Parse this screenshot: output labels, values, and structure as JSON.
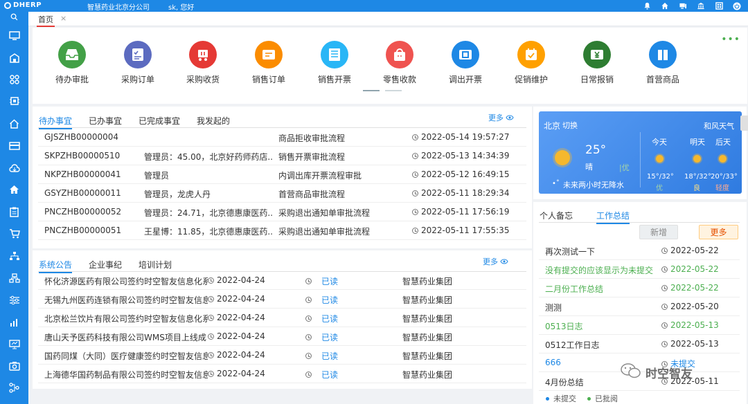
{
  "app": {
    "logo": "DHERP",
    "company": "智慧药业北京分公司",
    "greeting": "sk, 您好"
  },
  "tabs": {
    "home": "首页",
    "close": "×"
  },
  "modules": [
    {
      "label": "待办审批",
      "color": "#43a047",
      "icon": "inbox-tray-icon"
    },
    {
      "label": "采购订单",
      "color": "#5c6bc0",
      "icon": "checklist-icon"
    },
    {
      "label": "采购收货",
      "color": "#e53935",
      "icon": "cart-icon"
    },
    {
      "label": "销售订单",
      "color": "#fb8c00",
      "icon": "receipt-icon"
    },
    {
      "label": "销售开票",
      "color": "#29b6f6",
      "icon": "invoice-icon"
    },
    {
      "label": "零售收款",
      "color": "#ef5350",
      "icon": "shop-bag-icon"
    },
    {
      "label": "调出开票",
      "color": "#1e88e5",
      "icon": "transfer-invoice-icon"
    },
    {
      "label": "促销维护",
      "color": "#ffa000",
      "icon": "calendar-check-icon"
    },
    {
      "label": "日常报销",
      "color": "#2e7d32",
      "icon": "yen-ticket-icon"
    },
    {
      "label": "首营商品",
      "color": "#1e88e5",
      "icon": "product-box-icon"
    }
  ],
  "tasks": {
    "tabs": [
      "待办事宜",
      "已办事宜",
      "已完成事宜",
      "我发起的"
    ],
    "more": "更多",
    "rows": [
      {
        "id": "GJSZHB00000004",
        "desc": "",
        "flow": "商品拒收审批流程",
        "time": "2022-05-14 19:57:27"
      },
      {
        "id": "SKPZHB00000510",
        "desc": "管理员：45.00，北京好药师药店...",
        "flow": "销售开票审批流程",
        "time": "2022-05-13 14:34:39"
      },
      {
        "id": "NKPZHB00000041",
        "desc": "管理员",
        "flow": "内调出库开票流程审批",
        "time": "2022-05-12 16:49:15"
      },
      {
        "id": "GSYZHB00000011",
        "desc": "管理员，龙虎人丹",
        "flow": "首营商品审批流程",
        "time": "2022-05-11 18:29:34"
      },
      {
        "id": "PNCZHB00000052",
        "desc": "管理员：24.71，北京德惠康医药...",
        "flow": "采购退出通知单审批流程",
        "time": "2022-05-11 17:56:19"
      },
      {
        "id": "PNCZHB00000051",
        "desc": "王星博：11.85，北京德惠康医药...",
        "flow": "采购退出通知单审批流程",
        "time": "2022-05-11 17:55:35"
      }
    ]
  },
  "notices": {
    "tabs": [
      "系统公告",
      "企业事纪",
      "培训计划"
    ],
    "more": "更多",
    "rows": [
      {
        "title": "怀化济源医药有限公司签约时空智友信息化系",
        "date": "2022-04-24",
        "status": "已读",
        "org": "智慧药业集团"
      },
      {
        "title": "无锡九州医药连锁有限公司签约时空智友信息",
        "date": "2022-04-24",
        "status": "已读",
        "org": "智慧药业集团"
      },
      {
        "title": "北京松兰饮片有限公司签约时空智友信息化系",
        "date": "2022-04-24",
        "status": "已读",
        "org": "智慧药业集团"
      },
      {
        "title": "唐山天予医药科技有限公司WMS项目上线成",
        "date": "2022-04-24",
        "status": "已读",
        "org": "智慧药业集团"
      },
      {
        "title": "国药同煤（大同）医疗健康签约时空智友信息",
        "date": "2022-04-24",
        "status": "已读",
        "org": "智慧药业集团"
      },
      {
        "title": "上海德华国药制品有限公司签约时空智友信息",
        "date": "2022-04-24",
        "status": "已读",
        "org": "智慧药业集团"
      }
    ]
  },
  "weather": {
    "city": "北京",
    "switch": "切换",
    "provider": "和风天气",
    "temp": "25°",
    "cond": "晴",
    "aqi": "优",
    "forecast_note": "未来两小时无降水",
    "days": [
      {
        "label": "今天",
        "range": "15°/32°",
        "aqi": "优",
        "aqi_color": "#a5d6a7"
      },
      {
        "label": "明天",
        "range": "18°/32°",
        "aqi": "良",
        "aqi_color": "#ffe082"
      },
      {
        "label": "后天",
        "range": "20°/33°",
        "aqi": "轻度",
        "aqi_color": "#ffab91"
      }
    ]
  },
  "notes": {
    "tabs": [
      "个人备忘",
      "工作总结"
    ],
    "new_label": "新增",
    "more_label": "更多",
    "rows": [
      {
        "title": "再次测试一下",
        "date": "2022-05-22",
        "color": "#333333"
      },
      {
        "title": "没有提交的应该显示为未提交",
        "date": "2022-05-22",
        "color": "#4caf50"
      },
      {
        "title": "二月份工作总结",
        "date": "2022-05-22",
        "color": "#4caf50"
      },
      {
        "title": "测测",
        "date": "2022-05-20",
        "color": "#333333"
      },
      {
        "title": "0513日志",
        "date": "2022-05-13",
        "color": "#4caf50"
      },
      {
        "title": "0512工作日志",
        "date": "2022-05-13",
        "color": "#333333"
      },
      {
        "title": "666",
        "date": "未提交",
        "color": "#1e88e5"
      },
      {
        "title": "4月份总结",
        "date": "2022-05-11",
        "color": "#333333"
      }
    ],
    "legend": [
      "未提交",
      "已批阅"
    ]
  },
  "watermark": "时空智友"
}
